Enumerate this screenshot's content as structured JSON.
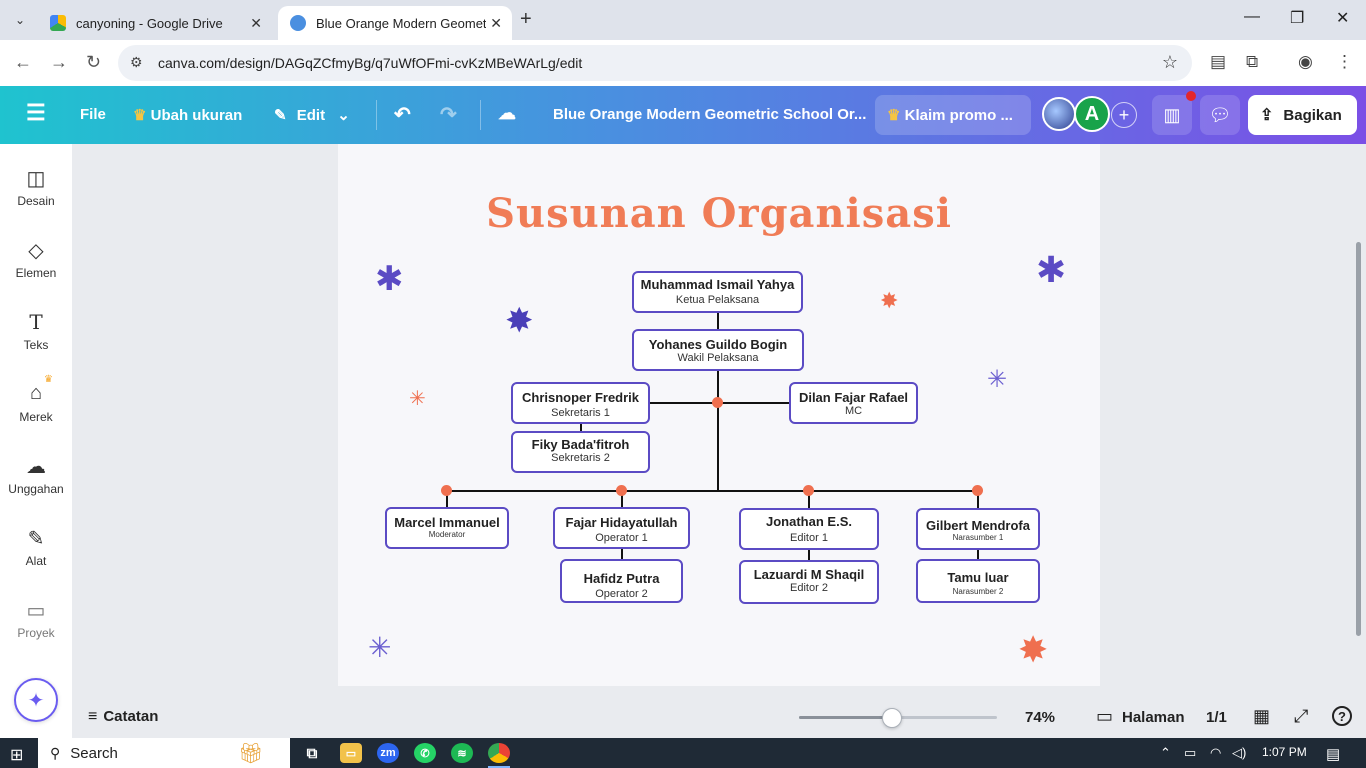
{
  "browser": {
    "tabs": [
      {
        "title": "canyoning - Google Drive",
        "active": false,
        "favicon_color": "#34a853"
      },
      {
        "title": "Blue Orange Modern Geometric",
        "active": true,
        "favicon_color": "#4a8fe0"
      }
    ],
    "url": "canva.com/design/DAGqZCfmyBg/q7uWfOFmi-cvKzMBeWArLg/edit"
  },
  "canva_header": {
    "file_label": "File",
    "resize_label": "Ubah ukuran",
    "edit_label": "Edit",
    "doc_title": "Blue Orange Modern Geometric School Or...",
    "promo_label": "Klaim promo ...",
    "avatar_letter": "A",
    "share_label": "Bagikan"
  },
  "sidebar": {
    "items": [
      {
        "label": "Desain",
        "icon": "design-icon"
      },
      {
        "label": "Elemen",
        "icon": "elements-icon"
      },
      {
        "label": "Teks",
        "icon": "text-icon"
      },
      {
        "label": "Merek",
        "icon": "brand-icon"
      },
      {
        "label": "Unggahan",
        "icon": "upload-icon"
      },
      {
        "label": "Alat",
        "icon": "tools-icon"
      },
      {
        "label": "Proyek",
        "icon": "folder-icon"
      }
    ]
  },
  "design": {
    "title": "Susunan Organisasi",
    "title_color": "#f07c56",
    "node_border_color": "#5b4bc4",
    "connector_dot_color": "#ef6f4f",
    "nodes": {
      "ketua": {
        "name": "Muhammad Ismail Yahya",
        "role": "Ketua Pelaksana"
      },
      "wakil": {
        "name": "Yohanes Guildo Bogin",
        "role": "Wakil Pelaksana"
      },
      "sekre1": {
        "name": "Chrisnoper Fredrik",
        "role": "Sekretaris 1"
      },
      "mc": {
        "name": "Dilan Fajar Rafael",
        "role": "MC"
      },
      "sekre2": {
        "name": "Fiky Bada'fitroh",
        "role": "Sekretaris 2"
      },
      "moderator": {
        "name": "Marcel Immanuel",
        "role": "Moderator"
      },
      "op1": {
        "name": "Fajar Hidayatullah",
        "role": "Operator 1"
      },
      "op2": {
        "name": "Hafidz Putra",
        "role": "Operator 2"
      },
      "ed1": {
        "name": "Jonathan E.S.",
        "role": "Editor 1"
      },
      "ed2": {
        "name": "Lazuardi M Shaqil",
        "role": "Editor 2"
      },
      "nara1": {
        "name": "Gilbert Mendrofa",
        "role": "Narasumber 1"
      },
      "nara2": {
        "name": "Tamu luar",
        "role": "Narasumber 2"
      }
    }
  },
  "bottom": {
    "notes_label": "Catatan",
    "zoom_percent": "74%",
    "zoom_level": 0.47,
    "pages_label": "Halaman",
    "page_count": "1/1",
    "help_label": "?"
  },
  "taskbar": {
    "search_label": "Search",
    "time": "1:07 PM"
  }
}
